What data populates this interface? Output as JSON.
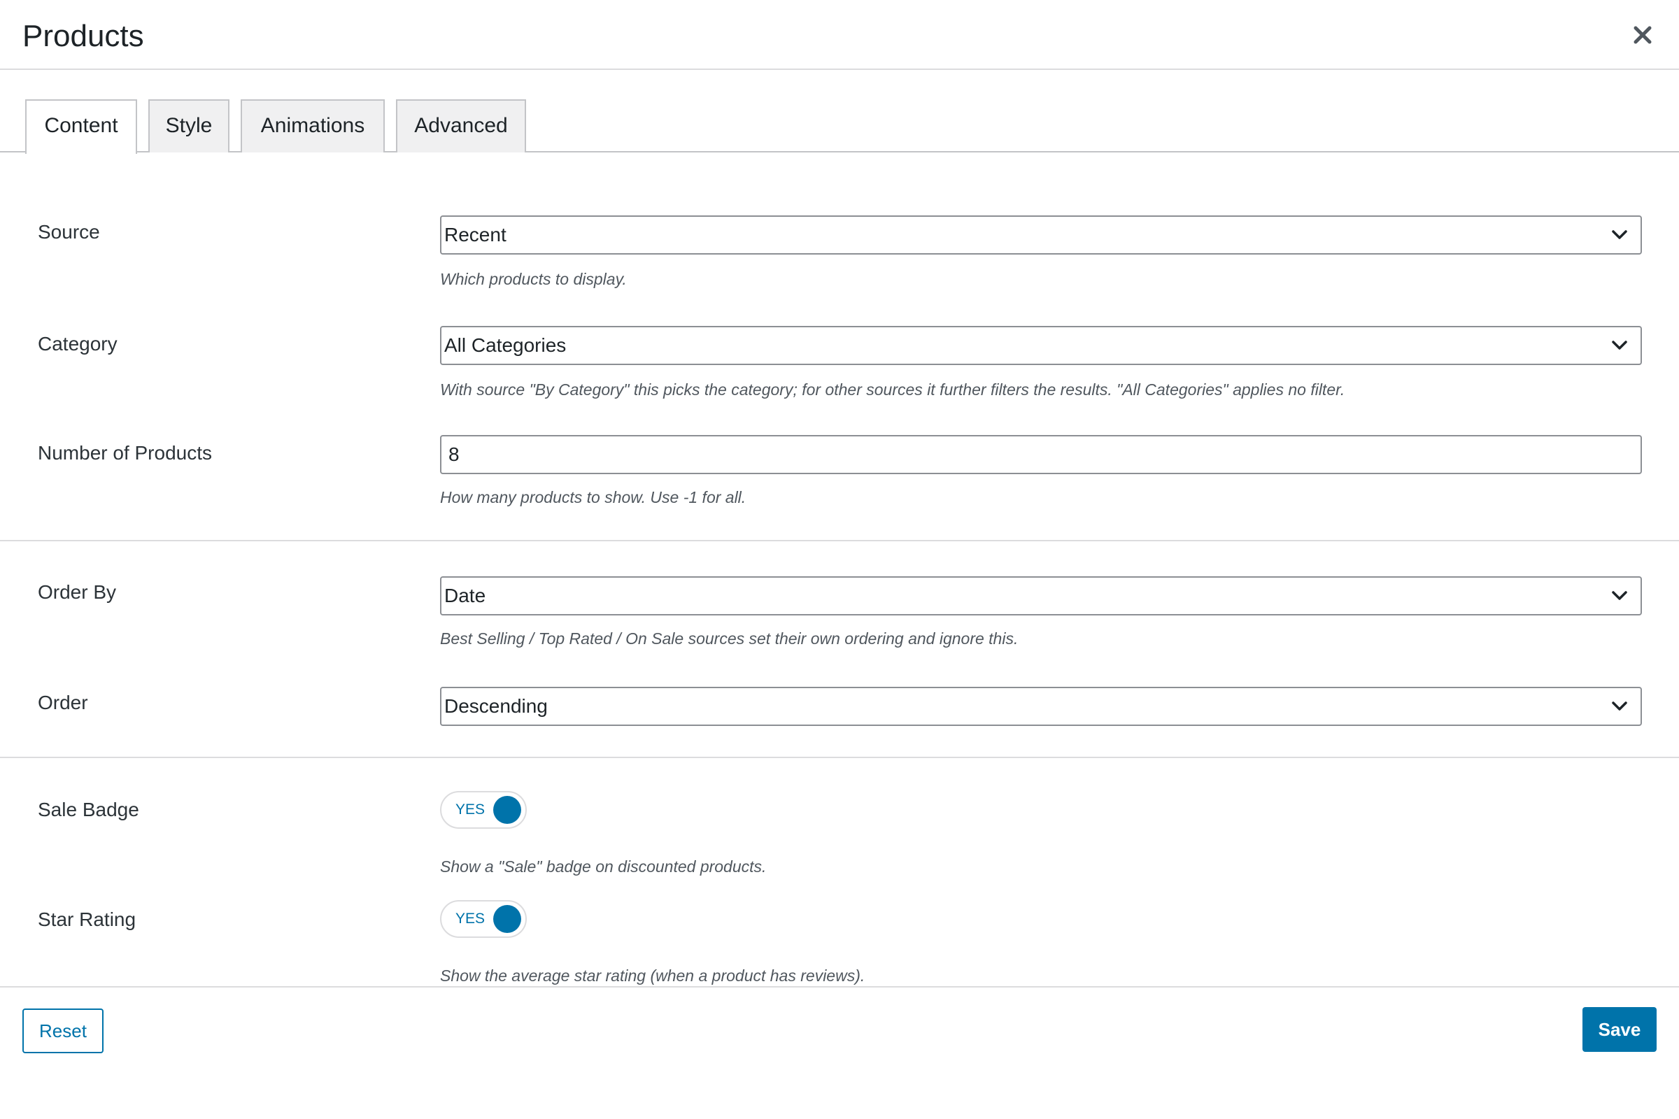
{
  "header": {
    "title": "Products",
    "close_icon": "close-icon"
  },
  "tabs": [
    {
      "label": "Content",
      "active": true
    },
    {
      "label": "Style",
      "active": false
    },
    {
      "label": "Animations",
      "active": false
    },
    {
      "label": "Advanced",
      "active": false
    }
  ],
  "fields": {
    "source": {
      "label": "Source",
      "value": "Recent",
      "help": "Which products to display."
    },
    "category": {
      "label": "Category",
      "value": "All Categories",
      "help": "With source \"By Category\" this picks the category; for other sources it further filters the results. \"All Categories\" applies no filter."
    },
    "number_of_products": {
      "label": "Number of Products",
      "value": "8",
      "help": "How many products to show. Use -1 for all."
    },
    "order_by": {
      "label": "Order By",
      "value": "Date",
      "help": "Best Selling / Top Rated / On Sale sources set their own ordering and ignore this."
    },
    "order": {
      "label": "Order",
      "value": "Descending"
    },
    "sale_badge": {
      "label": "Sale Badge",
      "toggle_text": "YES",
      "on": true,
      "help": "Show a \"Sale\" badge on discounted products."
    },
    "star_rating": {
      "label": "Star Rating",
      "toggle_text": "YES",
      "on": true,
      "help": "Show the average star rating (when a product has reviews)."
    }
  },
  "footer": {
    "reset_label": "Reset",
    "save_label": "Save"
  },
  "colors": {
    "accent": "#0073aa",
    "border": "#8c8f94",
    "divider": "#dcdcde",
    "tab_inactive_bg": "#f0f0f1",
    "help_text": "#50575e"
  }
}
